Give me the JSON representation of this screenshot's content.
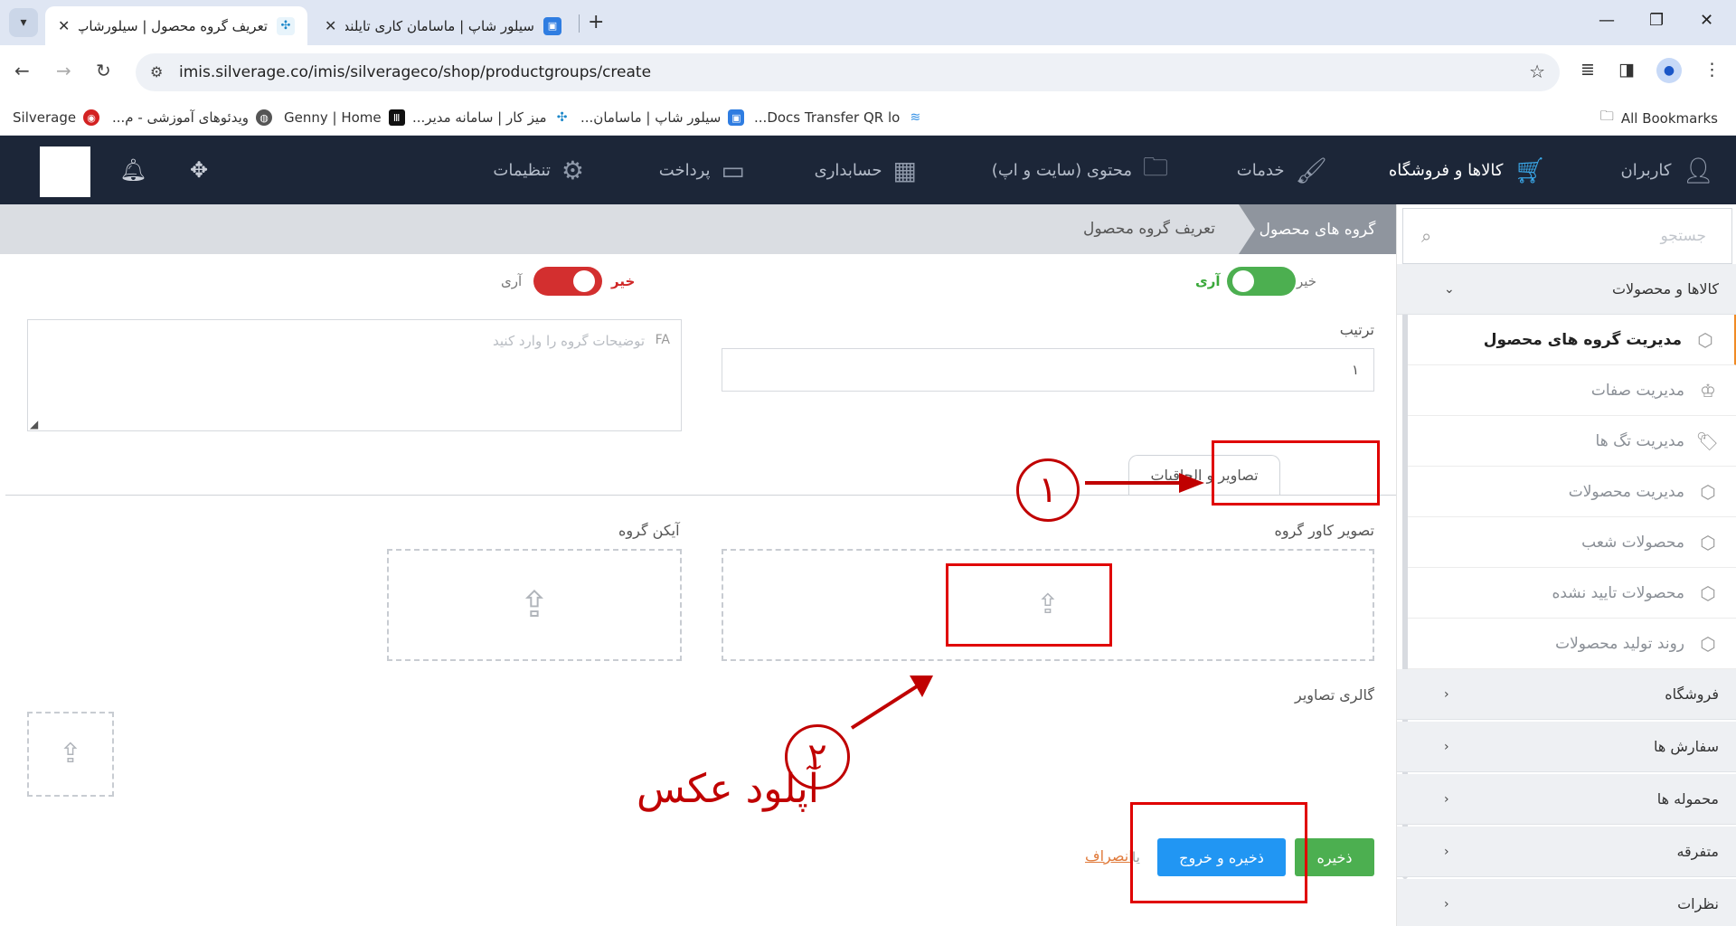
{
  "browser": {
    "tabs": [
      {
        "title": "تعریف گروه محصول | سیلورشاپ",
        "active": true
      },
      {
        "title": "سیلور شاپ | ماسامان کاری تایلند",
        "active": false
      }
    ],
    "new_tab": "+",
    "url": "imis.silverage.co/imis/silverageco/shop/productgroups/create",
    "bookmarks": [
      {
        "label": "Silverage"
      },
      {
        "label": "ویدئوهای آموزشی - م..."
      },
      {
        "label": "Genny | Home"
      },
      {
        "label": "میز کار | سامانه مدیر..."
      },
      {
        "label": "سیلور شاپ | ماسامان..."
      },
      {
        "label": "Docs Transfer QR lo..."
      }
    ],
    "all_bookmarks": "All Bookmarks"
  },
  "topnav": {
    "items": [
      {
        "label": "کاربران",
        "icon": "users-icon"
      },
      {
        "label": "کالاها و فروشگاه",
        "icon": "cart-icon"
      },
      {
        "label": "خدمات",
        "icon": "tools-icon"
      },
      {
        "label": "محتوی (سایت و اپ)",
        "icon": "folder-icon"
      },
      {
        "label": "حسابداری",
        "icon": "calculator-icon"
      },
      {
        "label": "پرداخت",
        "icon": "credit-card-icon"
      },
      {
        "label": "تنظیمات",
        "icon": "gears-icon"
      }
    ]
  },
  "sidebar": {
    "search_placeholder": "جستجو",
    "sections": [
      {
        "label": "کالاها و محصولات"
      },
      {
        "label": "فروشگاه"
      },
      {
        "label": "سفارش ها"
      },
      {
        "label": "محموله ها"
      },
      {
        "label": "متفرقه"
      },
      {
        "label": "نظرات"
      }
    ],
    "items": [
      {
        "label": "مدیریت گروه های محصول"
      },
      {
        "label": "مدیریت صفات"
      },
      {
        "label": "مدیریت تگ ها"
      },
      {
        "label": "مدیریت محصولات"
      },
      {
        "label": "محصولات شعب"
      },
      {
        "label": "محصولات تایید نشده"
      },
      {
        "label": "روند تولید محصولات"
      }
    ]
  },
  "breadcrumb": {
    "first": "گروه های محصول",
    "second": "تعریف گروه محصول"
  },
  "form": {
    "toggle1": {
      "no": "خیر",
      "yes": "آری",
      "state": "on",
      "color": "#4caf50"
    },
    "toggle2": {
      "no": "خیر",
      "yes": "آری",
      "state": "on",
      "color": "#d32f2f"
    },
    "order_label": "ترتیب",
    "order_value": "۱",
    "desc_placeholder": "توضیحات گروه را وارد کنید",
    "desc_lang": "FA",
    "tabs": [
      {
        "label": "تصاویر و الحاقیات"
      },
      {
        "label": "ص"
      }
    ],
    "cover_label": "تصویر کاور گروه",
    "icon_label": "آیکن گروه",
    "gallery_label": "گالری تصاویر",
    "buttons": {
      "save": "ذخیره",
      "save_exit": "ذخیره و خروج",
      "cancel": "انصراف",
      "cancel_prefix": "یا"
    }
  },
  "annotations": {
    "num1": "۱",
    "num2": "۲",
    "text": "آپلود عکس",
    "color": "#c00000"
  }
}
